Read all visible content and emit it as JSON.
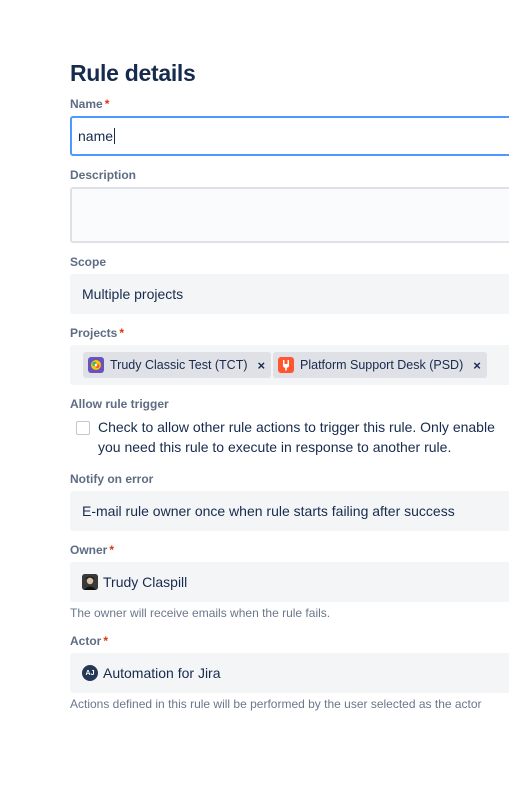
{
  "page": {
    "title": "Rule details"
  },
  "name": {
    "label": "Name",
    "required": "*",
    "value": "name"
  },
  "description": {
    "label": "Description",
    "value": ""
  },
  "scope": {
    "label": "Scope",
    "value": "Multiple projects"
  },
  "projects": {
    "label": "Projects",
    "required": "*",
    "tags": [
      {
        "label": "Trudy Classic Test (TCT)",
        "icon": "project-tct-icon",
        "remove": "×"
      },
      {
        "label": "Platform Support Desk (PSD)",
        "icon": "project-psd-icon",
        "remove": "×"
      }
    ]
  },
  "allow_trigger": {
    "label": "Allow rule trigger",
    "checked": false,
    "line1": "Check to allow other rule actions to trigger this rule. Only enable",
    "line2": "you need this rule to execute in response to another rule."
  },
  "notify": {
    "label": "Notify on error",
    "value": "E-mail rule owner once when rule starts failing after success"
  },
  "owner": {
    "label": "Owner",
    "required": "*",
    "value": "Trudy Claspill",
    "help": "The owner will receive emails when the rule fails."
  },
  "actor": {
    "label": "Actor",
    "required": "*",
    "value": "Automation for Jira",
    "avatar_initials": "AJ",
    "help": "Actions defined in this rule will be performed by the user selected as the actor"
  },
  "colors": {
    "focus": "#4c9aff",
    "required": "#de350b",
    "field_bg": "#f4f5f7",
    "tag_bg": "#dfe1e6"
  }
}
